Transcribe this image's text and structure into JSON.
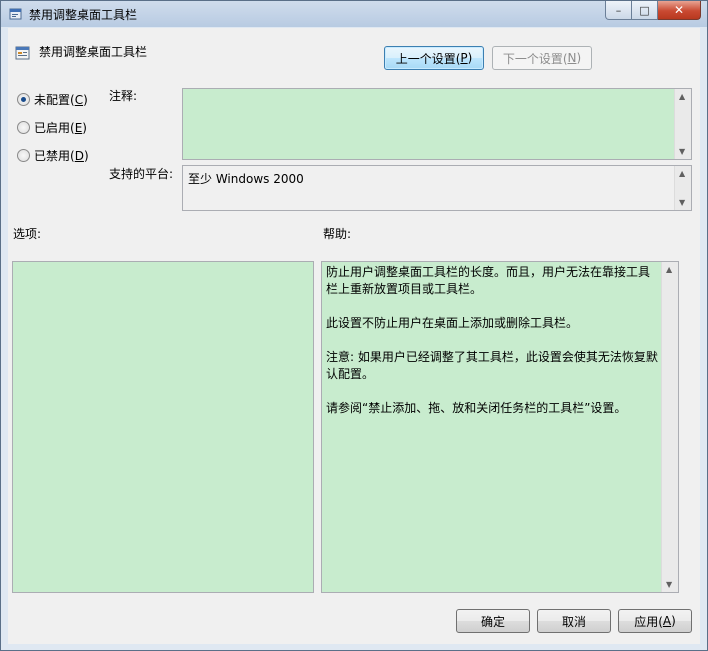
{
  "window": {
    "title": "禁用调整桌面工具栏",
    "controls": {
      "minimize": "–",
      "maximize": "□",
      "close": "✕"
    }
  },
  "header": {
    "title": "禁用调整桌面工具栏",
    "prev_label": "上一个设置(",
    "prev_key": "P",
    "next_label": "下一个设置(",
    "next_key": "N",
    "close_paren": ")"
  },
  "state": {
    "options": [
      {
        "label": "未配置(",
        "key": "C",
        "checked": true
      },
      {
        "label": "已启用(",
        "key": "E",
        "checked": false
      },
      {
        "label": "已禁用(",
        "key": "D",
        "checked": false
      }
    ]
  },
  "comment": {
    "label": "注释:",
    "value": ""
  },
  "platform": {
    "label": "支持的平台:",
    "value": "至少 Windows 2000"
  },
  "options_section": {
    "label": "选项:"
  },
  "help_section": {
    "label": "帮助:",
    "paragraphs": [
      "防止用户调整桌面工具栏的长度。而且，用户无法在靠接工具栏上重新放置项目或工具栏。",
      "此设置不防止用户在桌面上添加或删除工具栏。",
      "注意: 如果用户已经调整了其工具栏，此设置会使其无法恢复默认配置。",
      "请参阅“禁止添加、拖、放和关闭任务栏的工具栏”设置。"
    ]
  },
  "footer": {
    "ok": "确定",
    "cancel": "取消",
    "apply_label": "应用(",
    "apply_key": "A",
    "close_paren": ")"
  },
  "colors": {
    "field_bg": "#c8ecce",
    "window_bg": "#f0f0f0",
    "frame": "#dfe8f2"
  }
}
